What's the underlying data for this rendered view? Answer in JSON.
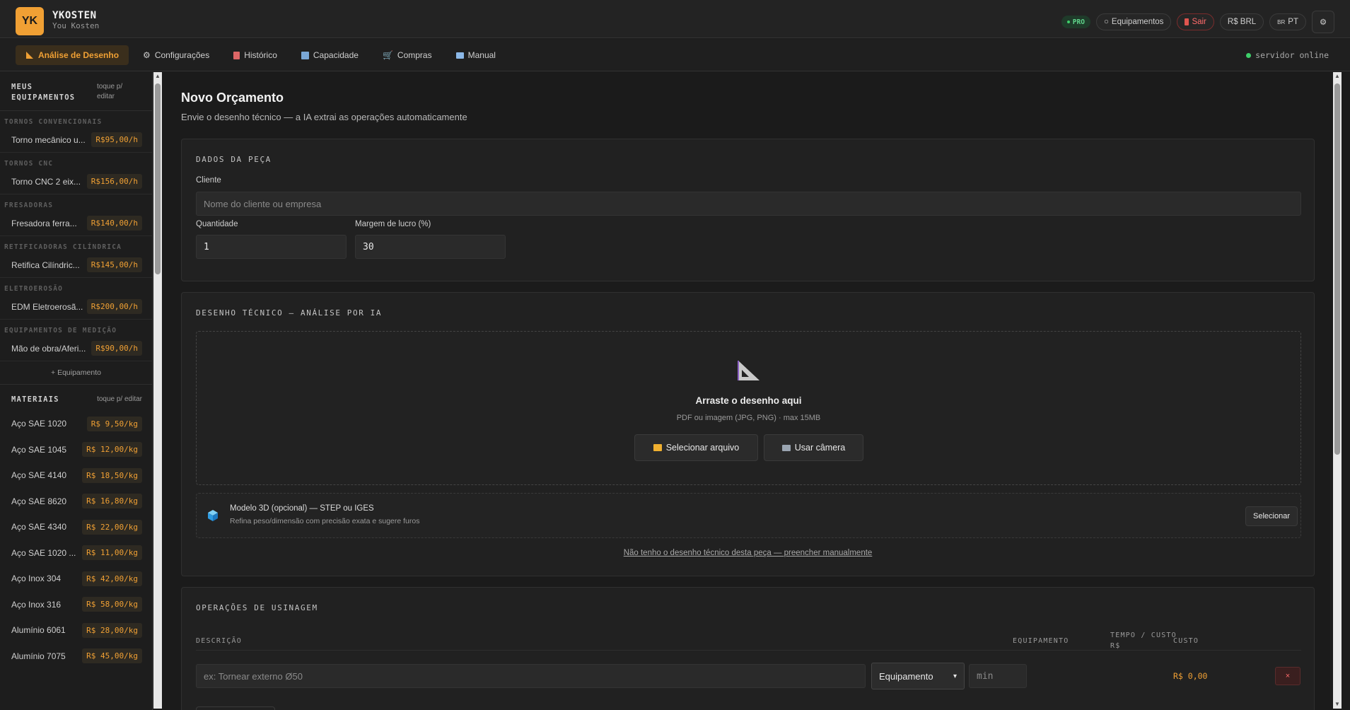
{
  "header": {
    "logo": "YK",
    "brand": "YKOSTEN",
    "sub": "You Kosten",
    "pro": "PRO",
    "equipment": "Equipamentos",
    "logout": "Sair",
    "currency": "R$ BRL",
    "lang_flag": "BR",
    "lang": "PT"
  },
  "nav": {
    "tabs": [
      "Análise de Desenho",
      "Configurações",
      "Histórico",
      "Capacidade",
      "Compras",
      "Manual"
    ],
    "server": "servidor online"
  },
  "sidebar": {
    "title": "MEUS EQUIPAMENTOS",
    "hint": "toque p/ editar",
    "groups": [
      {
        "category": "TORNOS CONVENCIONAIS",
        "name": "Torno mecânico u...",
        "price": "R$95,00/h"
      },
      {
        "category": "TORNOS CNC",
        "name": "Torno CNC 2 eix...",
        "price": "R$156,00/h"
      },
      {
        "category": "FRESADORAS",
        "name": "Fresadora ferra...",
        "price": "R$140,00/h"
      },
      {
        "category": "RETIFICADORAS CILÍNDRICA",
        "name": "Retifica Cilíndric...",
        "price": "R$145,00/h"
      },
      {
        "category": "ELETROEROSÃO",
        "name": "EDM Eletroerosã...",
        "price": "R$200,00/h"
      },
      {
        "category": "EQUIPAMENTOS DE MEDIÇÃO",
        "name": "Mão de obra/Aferi...",
        "price": "R$90,00/h"
      }
    ],
    "add": "+ Equipamento",
    "materials_title": "MATERIAIS",
    "materials_hint": "toque p/ editar",
    "materials": [
      {
        "name": "Aço SAE 1020",
        "price": "R$ 9,50/kg"
      },
      {
        "name": "Aço SAE 1045",
        "price": "R$ 12,00/kg"
      },
      {
        "name": "Aço SAE 4140",
        "price": "R$ 18,50/kg"
      },
      {
        "name": "Aço SAE 8620",
        "price": "R$ 16,80/kg"
      },
      {
        "name": "Aço SAE 4340",
        "price": "R$ 22,00/kg"
      },
      {
        "name": "Aço SAE 1020 ...",
        "price": "R$ 11,00/kg"
      },
      {
        "name": "Aço Inox 304",
        "price": "R$ 42,00/kg"
      },
      {
        "name": "Aço Inox 316",
        "price": "R$ 58,00/kg"
      },
      {
        "name": "Alumínio 6061",
        "price": "R$ 28,00/kg"
      },
      {
        "name": "Alumínio 7075",
        "price": "R$ 45,00/kg"
      }
    ]
  },
  "main": {
    "title": "Novo Orçamento",
    "subtitle": "Envie o desenho técnico — a IA extrai as operações automaticamente",
    "part": {
      "title": "DADOS DA PEÇA",
      "client_label": "Cliente",
      "client_placeholder": "Nome do cliente ou empresa",
      "qty_label": "Quantidade",
      "qty_value": "1",
      "margin_label": "Margem de lucro (%)",
      "margin_value": "30"
    },
    "drawing": {
      "title": "DESENHO TÉCNICO — ANÁLISE POR IA",
      "drop_title": "Arraste o desenho aqui",
      "drop_sub": "PDF ou imagem (JPG, PNG) · max 15MB",
      "select_file": "Selecionar arquivo",
      "use_camera": "Usar câmera",
      "model_title": "Modelo 3D (opcional) — STEP ou IGES",
      "model_sub": "Refina peso/dimensão com precisão exata e sugere furos",
      "model_button": "Selecionar",
      "manual_link": "Não tenho o desenho técnico desta peça — preencher manualmente"
    },
    "ops": {
      "title": "OPERAÇÕES DE USINAGEM",
      "col_desc": "DESCRIÇÃO",
      "col_equip": "EQUIPAMENTO",
      "col_time_1": "TEMPO / CUSTO",
      "col_time_2": "R$",
      "col_cost": "CUSTO",
      "desc_placeholder": "ex: Tornear externo Ø50",
      "equip_value": "Equipamento",
      "time_placeholder": "min",
      "cost_value": "R$ 0,00",
      "remove": "×"
    }
  }
}
